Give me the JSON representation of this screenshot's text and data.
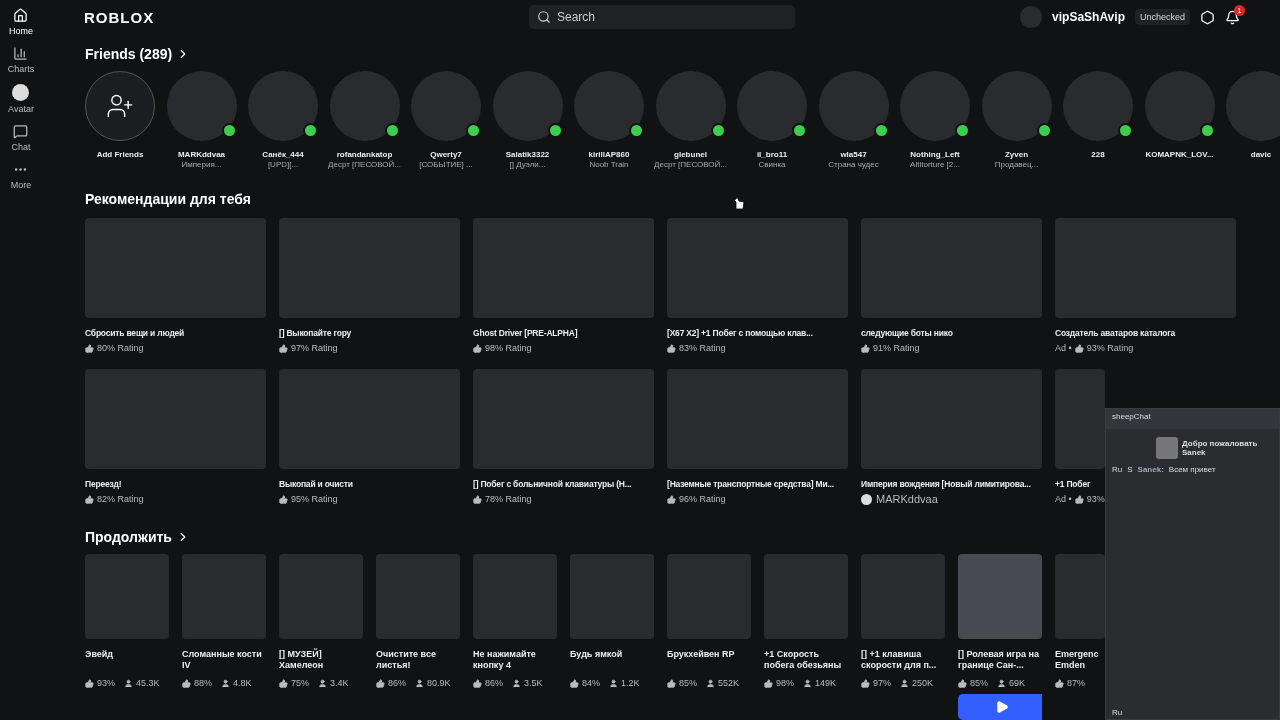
{
  "sidebar": {
    "items": [
      {
        "label": "Home",
        "kind": "home",
        "selected": true
      },
      {
        "label": "Charts",
        "kind": "charts",
        "selected": false
      },
      {
        "label": "Avatar",
        "kind": "avatar",
        "selected": false
      },
      {
        "label": "Chat",
        "kind": "chat",
        "selected": false
      },
      {
        "label": "More",
        "kind": "more",
        "selected": false
      }
    ]
  },
  "header": {
    "logo": "ROBLOX",
    "search": {
      "placeholder": "Search"
    },
    "username": "vipSaShAvip",
    "age_badge": "Unchecked",
    "notifications": "1"
  },
  "friends": {
    "title": "Friends (289)",
    "add_label": "Add Friends",
    "items": [
      {
        "name": "MARKddvaa",
        "status": "Империя...",
        "online": true
      },
      {
        "name": "Санёк_444",
        "status": "[UPD][...",
        "online": true
      },
      {
        "name": "rofandankatop",
        "status": "Десрт [ПЕСОВОЙ...",
        "online": true
      },
      {
        "name": "Qwerty7",
        "status": "[СОБЫТИЕ] ...",
        "online": true
      },
      {
        "name": "Salatik3322",
        "status": "[] Дуэли...",
        "online": true
      },
      {
        "name": "kirillAP860",
        "status": "Noob Train",
        "online": true
      },
      {
        "name": "glebunel",
        "status": "Десрт [ПЕСОВОЙ...",
        "online": true
      },
      {
        "name": "il_bro11",
        "status": "Свинка",
        "online": true
      },
      {
        "name": "wla547",
        "status": "Страна чудес",
        "online": true
      },
      {
        "name": "Nothing_Left",
        "status": "Altitorture [2...",
        "online": true
      },
      {
        "name": "Zyven",
        "status": "Продавец...",
        "online": true
      },
      {
        "name": "228",
        "online": true
      },
      {
        "name": "KOMAPNK_LOV...",
        "online": true
      },
      {
        "name": "davic",
        "online": false
      }
    ]
  },
  "recommendations": {
    "title": "Рекомендации для тебя",
    "rows": [
      [
        {
          "title": "Сбросить вещи и людей",
          "rating": "80% Rating"
        },
        {
          "title": "[] Выкопайте гору",
          "rating": "97% Rating"
        },
        {
          "title": "Ghost Driver [PRE-ALPHA]",
          "rating": "98% Rating"
        },
        {
          "title": "[X67 X2] +1 Побег с помощью клав...",
          "rating": "83% Rating"
        },
        {
          "title": "следующие боты нико",
          "rating": "91% Rating"
        },
        {
          "title": "Создатель аватаров каталога",
          "ad": "Ad •",
          "rating": "93% Rating"
        }
      ],
      [
        {
          "title": "Переезд!",
          "rating": "82% Rating"
        },
        {
          "title": "Выкопай и очисти",
          "rating": "95% Rating"
        },
        {
          "title": "[] Побег с больничной клавиатуры (Н...",
          "rating": "78% Rating"
        },
        {
          "title": "[Наземные транспортные средства] Ми...",
          "rating": "96% Rating"
        },
        {
          "title": "Империя вождения [Новый лимитирова...",
          "creator": "MARKddvaa"
        },
        {
          "title": "+1 Побег",
          "ad": "Ad •",
          "rating": "93%"
        }
      ]
    ]
  },
  "continue": {
    "title": "Продолжить",
    "items": [
      {
        "title": "Эвейд",
        "rating": "93%",
        "players": "45.3K",
        "hovered": false
      },
      {
        "title": "Сломанные кости IV",
        "rating": "88%",
        "players": "4.8K",
        "hovered": false
      },
      {
        "title": "[] МУЗЕЙ] Хамелеон",
        "rating": "75%",
        "players": "3.4K",
        "hovered": false
      },
      {
        "title": "Очистите все листья!",
        "rating": "86%",
        "players": "80.9K",
        "hovered": false
      },
      {
        "title": "Не нажимайте кнопку 4",
        "rating": "86%",
        "players": "3.5K",
        "hovered": false
      },
      {
        "title": "Будь ямкой",
        "rating": "84%",
        "players": "1.2K",
        "hovered": false
      },
      {
        "title": "Брукхейвен RP",
        "rating": "85%",
        "players": "552K",
        "hovered": false
      },
      {
        "title": "+1 Скорость побега обезьяны",
        "rating": "98%",
        "players": "149K",
        "hovered": false
      },
      {
        "title": "[] +1 клавиша скорости для п...",
        "rating": "97%",
        "players": "250K",
        "hovered": false
      },
      {
        "title": "[] Ролевая игра на границе Сан-...",
        "rating": "85%",
        "players": "69K",
        "hovered": true
      },
      {
        "title": "Emergenc Emden",
        "rating": "87%",
        "hovered": false
      }
    ]
  },
  "chat": {
    "title": "sheepChat",
    "welcome": "Добро пожаловать",
    "welcome_name": "Sanek",
    "messages": [
      {
        "lang": "Ru",
        "initial": "S",
        "author": "Sanek:",
        "text": "Всем привет"
      }
    ],
    "footer_lang": "Ru"
  }
}
